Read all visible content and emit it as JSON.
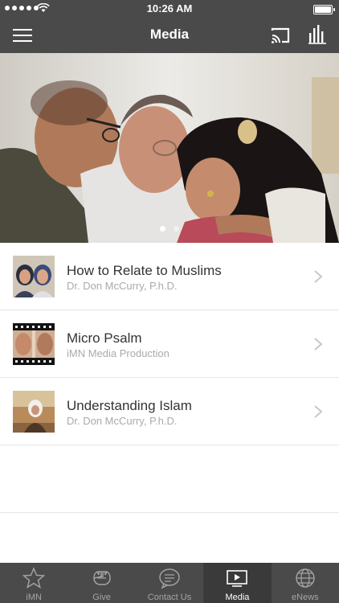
{
  "status_bar": {
    "time": "10:26 AM"
  },
  "nav": {
    "title": "Media"
  },
  "hero": {
    "page_count": 2,
    "active_page": 1
  },
  "media_items": [
    {
      "title": "How to Relate to Muslims",
      "subtitle": "Dr. Don McCurry, P.h.D."
    },
    {
      "title": "Micro Psalm",
      "subtitle": "iMN Media Production"
    },
    {
      "title": "Understanding Islam",
      "subtitle": "Dr. Don McCurry, P.h.D."
    }
  ],
  "tabs": [
    {
      "label": "iMN",
      "icon": "star-icon",
      "active": false
    },
    {
      "label": "Give",
      "icon": "hands-icon",
      "active": false
    },
    {
      "label": "Contact Us",
      "icon": "chat-bubble-icon",
      "active": false
    },
    {
      "label": "Media",
      "icon": "play-screen-icon",
      "active": true
    },
    {
      "label": "eNews",
      "icon": "globe-icon",
      "active": false
    }
  ],
  "colors": {
    "bar_background": "#4a4a4a",
    "active_tab_background": "#3a3a3a",
    "inactive_tab_text": "#a5a5a5",
    "subtitle_text": "#aaaaaa"
  }
}
